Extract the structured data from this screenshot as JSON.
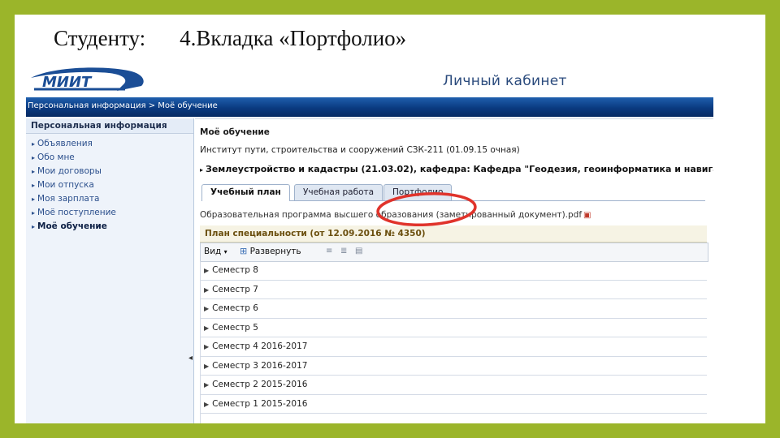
{
  "slide": {
    "title_left": "Студенту:",
    "title_right": "4.Вкладка «Портфолио»",
    "frame_color": "#9bb52a"
  },
  "header": {
    "logo_text": "МИИТ",
    "cabinet_title": "Личный кабинет",
    "brand_color": "#1b4e96"
  },
  "breadcrumb": {
    "root": "Персональная информация",
    "separator": ">",
    "current": "Моё обучение"
  },
  "sidebar": {
    "title": "Персональная информация",
    "items": [
      {
        "label": "Объявления",
        "active": false
      },
      {
        "label": "Обо мне",
        "active": false
      },
      {
        "label": "Мои договоры",
        "active": false
      },
      {
        "label": "Мои отпуска",
        "active": false
      },
      {
        "label": "Моя зарплата",
        "active": false
      },
      {
        "label": "Моё поступление",
        "active": false
      },
      {
        "label": "Моё обучение",
        "active": true
      }
    ]
  },
  "main": {
    "title": "Моё обучение",
    "institute": "Институт пути, строительства и сооружений СЗК-211 (01.09.15 очная)",
    "specialty": "Землеустройство и кадастры (21.03.02), кафедра: Кафедра \"Геодезия, геоинформатика и навигация\"",
    "tabs": [
      {
        "label": "Учебный план",
        "active": true
      },
      {
        "label": "Учебная работа",
        "active": false
      },
      {
        "label": "Портфолио",
        "active": false,
        "highlighted": true
      }
    ],
    "program_link": "Образовательная программа высшего образования (заметированный документ).pdf",
    "plan_title": "План специальности (от 12.09.2016 № 4350)",
    "toolbar": {
      "view_label": "Вид",
      "expand_label": "Развернуть"
    },
    "semesters": [
      "Семестр 8",
      "Семестр 7",
      "Семестр 6",
      "Семестр 5",
      "Семестр 4 2016-2017",
      "Семестр 3 2016-2017",
      "Семестр 2 2015-2016",
      "Семестр 1 2015-2016"
    ],
    "highlight_color": "#e0332b"
  }
}
